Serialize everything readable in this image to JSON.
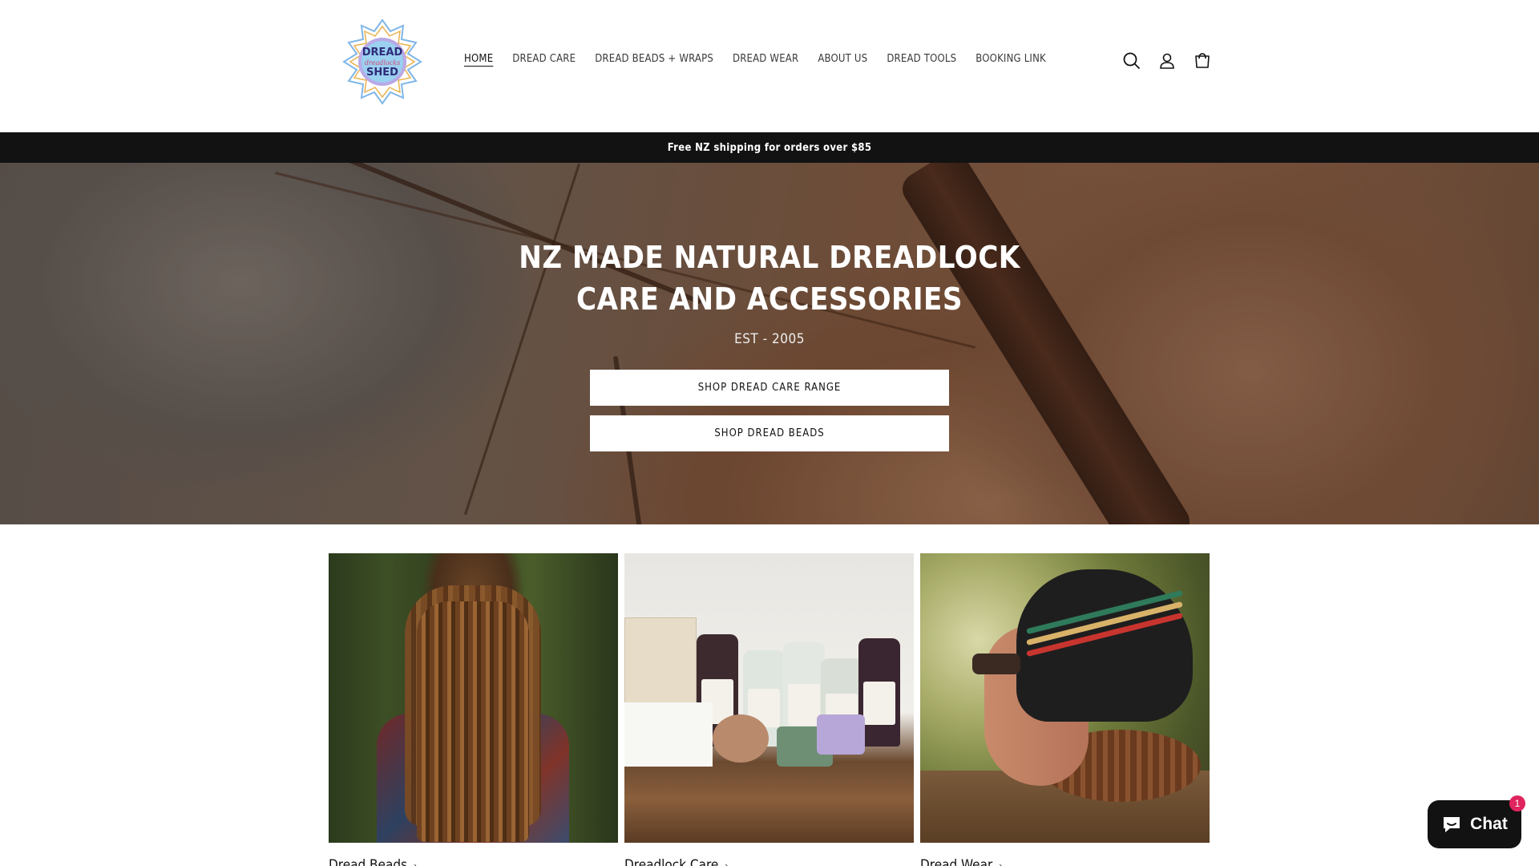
{
  "header": {
    "logo_alt": "Dread Shed",
    "nav": [
      {
        "label": "HOME",
        "active": true
      },
      {
        "label": "DREAD CARE"
      },
      {
        "label": "DREAD BEADS + WRAPS"
      },
      {
        "label": "DREAD WEAR"
      },
      {
        "label": "ABOUT US"
      },
      {
        "label": "DREAD TOOLS"
      },
      {
        "label": "BOOKING LINK"
      }
    ],
    "icons": [
      "search-icon",
      "account-icon",
      "cart-icon"
    ]
  },
  "announcement": {
    "text": "Free NZ shipping for orders over $85"
  },
  "hero": {
    "title": "NZ MADE NATURAL DREADLOCK CARE AND ACCESSORIES",
    "subtitle": "EST - 2005",
    "buttons": [
      "SHOP DREAD CARE RANGE",
      "SHOP DREAD BEADS"
    ]
  },
  "collections": [
    {
      "label": "Dread Beads",
      "icon": "arrow-right-icon"
    },
    {
      "label": "Dreadlock Care",
      "icon": "arrow-right-icon"
    },
    {
      "label": "Dread Wear",
      "icon": "arrow-right-icon"
    }
  ],
  "chat": {
    "label": "Chat",
    "badge": "1"
  },
  "colors": {
    "accent": "#121212",
    "announcement_bg": "#121212",
    "badge": "#e0245e",
    "background": "#ffffff"
  }
}
